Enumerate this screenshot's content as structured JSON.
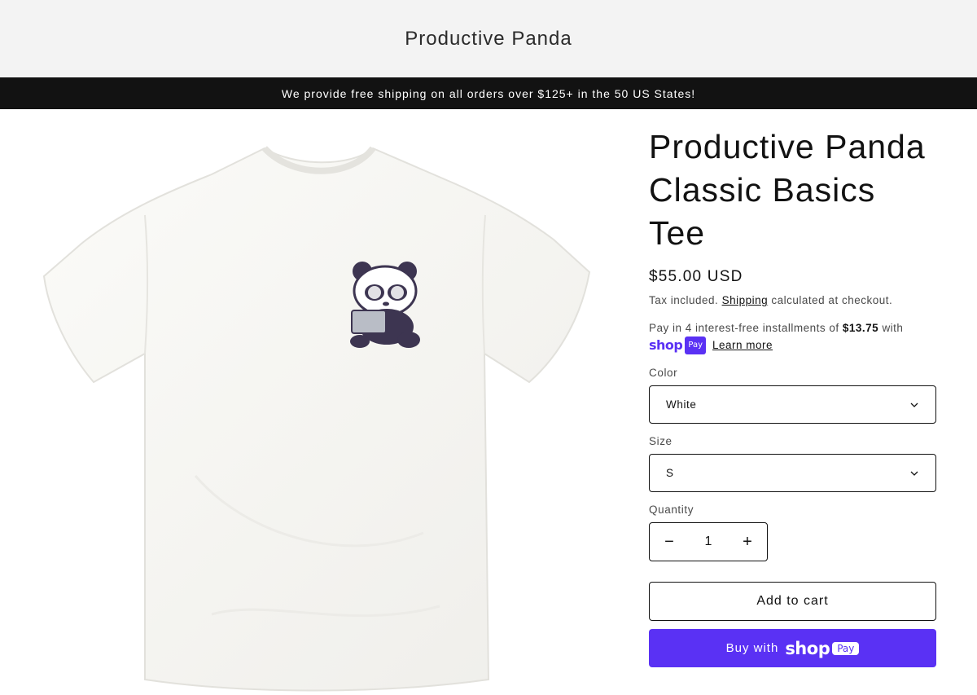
{
  "header": {
    "site_title": "Productive Panda"
  },
  "announcement": {
    "text": "We provide free shipping on all orders over $125+ in the 50 US States!"
  },
  "product": {
    "title_lines": [
      "Productive Panda",
      "Classic Basics",
      "Tee"
    ],
    "price": "$55.00 USD",
    "tax_prefix": "Tax included.",
    "shipping_link": "Shipping",
    "tax_suffix": "calculated at checkout.",
    "installments_prefix": "Pay in 4 interest-free installments of",
    "installment_amount": "$13.75",
    "installments_suffix": "with",
    "shop_logo_text": "shop",
    "shop_pay_pill": "Pay",
    "learn_more": "Learn more"
  },
  "options": {
    "color": {
      "label": "Color",
      "selected": "White"
    },
    "size": {
      "label": "Size",
      "selected": "S"
    },
    "quantity": {
      "label": "Quantity",
      "value": "1",
      "decrement": "−",
      "increment": "+"
    }
  },
  "buttons": {
    "add_to_cart": "Add to cart",
    "buy_with": "Buy with",
    "buy_logo_text": "shop",
    "buy_pill": "Pay"
  },
  "colors": {
    "header_bg": "#f3f3f3",
    "announcement_bg": "#121212",
    "shop_pay_purple": "#5a31f4"
  },
  "icons": {
    "select_chevron": "chevron-down-icon",
    "qty_minus": "minus-icon",
    "qty_plus": "plus-icon"
  }
}
